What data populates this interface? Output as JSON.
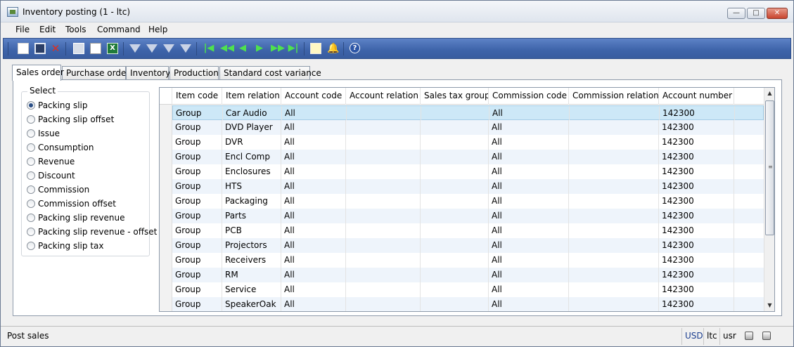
{
  "window": {
    "title": "Inventory posting (1 - ltc)",
    "controls": {
      "minimize": "—",
      "maximize": "□",
      "close": "✕"
    }
  },
  "menu": [
    "File",
    "Edit",
    "Tools",
    "Command",
    "Help"
  ],
  "toolbar": {
    "icons": [
      "new-icon",
      "save-icon",
      "delete-icon",
      "print-icon",
      "print-preview-icon",
      "export-excel-icon",
      "filter-icon",
      "filter-selection-icon",
      "filter-advanced-icon",
      "remove-filter-icon",
      "first-record-icon",
      "previous-page-icon",
      "previous-record-icon",
      "next-record-icon",
      "next-page-icon",
      "last-record-icon",
      "document-handling-icon",
      "alerts-icon",
      "help-icon"
    ]
  },
  "tabs": [
    {
      "label": "Sales order",
      "active": true
    },
    {
      "label": "Purchase order",
      "active": false
    },
    {
      "label": "Inventory",
      "active": false
    },
    {
      "label": "Production",
      "active": false
    },
    {
      "label": "Standard cost variance",
      "active": false
    }
  ],
  "select_group": {
    "label": "Select",
    "options": [
      {
        "label": "Packing slip",
        "checked": true
      },
      {
        "label": "Packing slip offset",
        "checked": false
      },
      {
        "label": "Issue",
        "checked": false
      },
      {
        "label": "Consumption",
        "checked": false
      },
      {
        "label": "Revenue",
        "checked": false
      },
      {
        "label": "Discount",
        "checked": false
      },
      {
        "label": "Commission",
        "checked": false
      },
      {
        "label": "Commission offset",
        "checked": false
      },
      {
        "label": "Packing slip revenue",
        "checked": false
      },
      {
        "label": "Packing slip revenue - offset",
        "checked": false
      },
      {
        "label": "Packing slip tax",
        "checked": false
      }
    ]
  },
  "grid": {
    "columns": [
      "Item code",
      "Item relation",
      "Account code",
      "Account relation",
      "Sales tax group",
      "Commission code",
      "Commission relation",
      "Account number"
    ],
    "rows": [
      [
        "Group",
        "Car Audio",
        "All",
        "",
        "",
        "All",
        "",
        "142300"
      ],
      [
        "Group",
        "DVD Player",
        "All",
        "",
        "",
        "All",
        "",
        "142300"
      ],
      [
        "Group",
        "DVR",
        "All",
        "",
        "",
        "All",
        "",
        "142300"
      ],
      [
        "Group",
        "Encl Comp",
        "All",
        "",
        "",
        "All",
        "",
        "142300"
      ],
      [
        "Group",
        "Enclosures",
        "All",
        "",
        "",
        "All",
        "",
        "142300"
      ],
      [
        "Group",
        "HTS",
        "All",
        "",
        "",
        "All",
        "",
        "142300"
      ],
      [
        "Group",
        "Packaging",
        "All",
        "",
        "",
        "All",
        "",
        "142300"
      ],
      [
        "Group",
        "Parts",
        "All",
        "",
        "",
        "All",
        "",
        "142300"
      ],
      [
        "Group",
        "PCB",
        "All",
        "",
        "",
        "All",
        "",
        "142300"
      ],
      [
        "Group",
        "Projectors",
        "All",
        "",
        "",
        "All",
        "",
        "142300"
      ],
      [
        "Group",
        "Receivers",
        "All",
        "",
        "",
        "All",
        "",
        "142300"
      ],
      [
        "Group",
        "RM",
        "All",
        "",
        "",
        "All",
        "",
        "142300"
      ],
      [
        "Group",
        "Service",
        "All",
        "",
        "",
        "All",
        "",
        "142300"
      ],
      [
        "Group",
        "SpeakerOak",
        "All",
        "",
        "",
        "All",
        "",
        "142300"
      ]
    ],
    "selected_row": 0
  },
  "status": {
    "text": "Post sales",
    "currency": "USD",
    "company": "ltc",
    "layer": "usr"
  }
}
